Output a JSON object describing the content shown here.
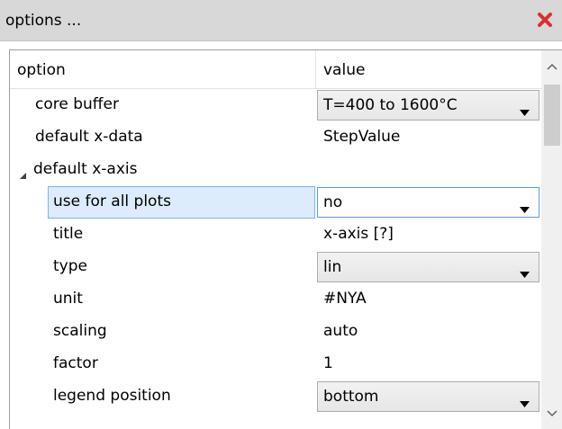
{
  "window": {
    "title": "options ...",
    "close_icon": "close-icon",
    "close_color": "#d9302c"
  },
  "table": {
    "headers": {
      "option": "option",
      "value": "value"
    },
    "rows": [
      {
        "name": "core buffer",
        "value": "T=400 to 1600°C",
        "editor": "combo"
      },
      {
        "name": "default x-data",
        "value": "StepValue",
        "editor": "text"
      },
      {
        "name": "default x-axis",
        "value": "",
        "editor": "group",
        "expanded": true
      },
      {
        "name": "use for all plots",
        "value": "no",
        "editor": "combo",
        "selected": true
      },
      {
        "name": "title",
        "value": "x-axis [?]",
        "editor": "text"
      },
      {
        "name": "type",
        "value": "lin",
        "editor": "combo"
      },
      {
        "name": "unit",
        "value": "#NYA",
        "editor": "text"
      },
      {
        "name": "scaling",
        "value": "auto",
        "editor": "text"
      },
      {
        "name": "factor",
        "value": "1",
        "editor": "text"
      },
      {
        "name": "legend position",
        "value": "bottom",
        "editor": "combo"
      }
    ]
  },
  "scrollbar": {
    "up_icon": "chevron-up-icon",
    "down_icon": "chevron-down-icon"
  }
}
